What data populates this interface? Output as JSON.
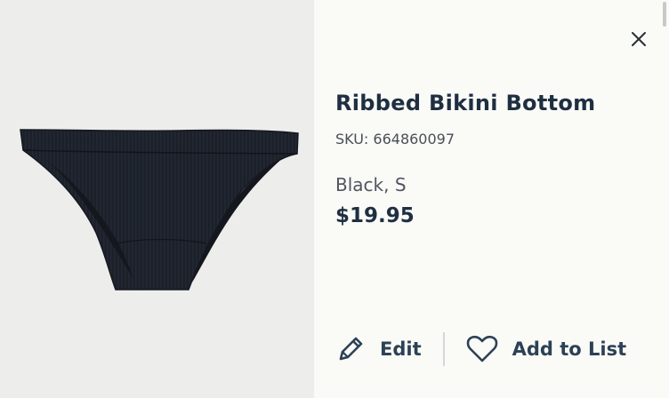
{
  "product": {
    "title": "Ribbed Bikini Bottom",
    "sku": "SKU: 664860097",
    "variant": "Black, S",
    "price": "$19.95",
    "image_alt": "Ribbed Bikini Bottom",
    "color_hex": "#1b1f29"
  },
  "actions": {
    "edit_label": "Edit",
    "add_to_list_label": "Add to List"
  },
  "icons": {
    "close": "close-icon",
    "edit": "pencil-icon",
    "wishlist": "heart-icon"
  },
  "colors": {
    "text_primary": "#1f2f42",
    "text_secondary": "#505560",
    "image_background": "#ededeb"
  }
}
